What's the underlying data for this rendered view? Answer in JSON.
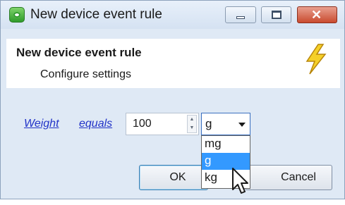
{
  "window": {
    "title": "New device event rule"
  },
  "header": {
    "title": "New device event rule",
    "subtitle": "Configure settings",
    "icon": "lightning-bolt-icon"
  },
  "rule": {
    "field_link": "Weight",
    "operator_link": "equals",
    "value": "100",
    "unit_selected": "g",
    "unit_options": [
      "mg",
      "g",
      "kg"
    ],
    "highlighted_option": "g"
  },
  "buttons": {
    "ok": "OK",
    "cancel": "Cancel"
  },
  "colors": {
    "link": "#2233c8",
    "selection": "#3399ff",
    "close_button": "#c94a2f"
  }
}
